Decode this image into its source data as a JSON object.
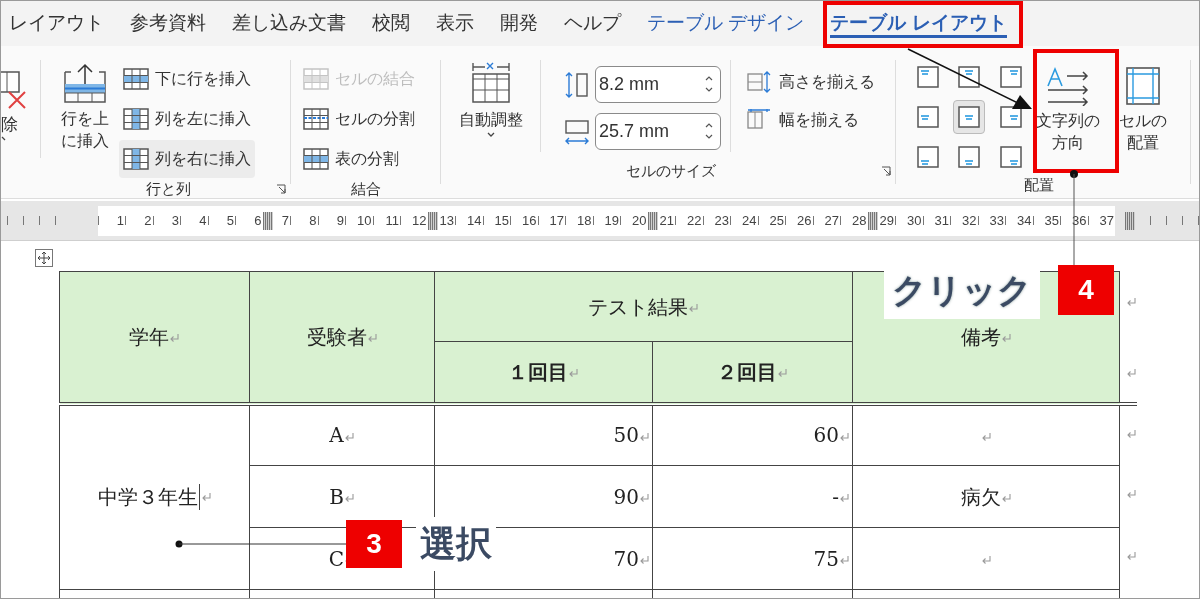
{
  "tabs": [
    {
      "label": "レイアウト",
      "selected": false,
      "kind": "normal"
    },
    {
      "label": "参考資料",
      "selected": false,
      "kind": "normal"
    },
    {
      "label": "差し込み文書",
      "selected": false,
      "kind": "normal"
    },
    {
      "label": "校閲",
      "selected": false,
      "kind": "normal"
    },
    {
      "label": "表示",
      "selected": false,
      "kind": "normal"
    },
    {
      "label": "開発",
      "selected": false,
      "kind": "normal"
    },
    {
      "label": "ヘルプ",
      "selected": false,
      "kind": "normal"
    },
    {
      "label": "テーブル デザイン",
      "selected": false,
      "kind": "context"
    },
    {
      "label": "テーブル レイアウト",
      "selected": true,
      "kind": "context"
    }
  ],
  "ribbon": {
    "delete_group": {
      "label": "除"
    },
    "rows_columns": {
      "title": "行と列",
      "insert_above": [
        "行を上",
        "に挿入"
      ],
      "items": [
        {
          "label": "下に行を挿入",
          "selected": false
        },
        {
          "label": "列を左に挿入",
          "selected": false
        },
        {
          "label": "列を右に挿入",
          "selected": true
        }
      ]
    },
    "merge": {
      "title": "結合",
      "items": [
        {
          "label": "セルの結合",
          "disabled": true
        },
        {
          "label": "セルの分割",
          "disabled": false
        },
        {
          "label": "表の分割",
          "disabled": false
        }
      ]
    },
    "cell_size": {
      "title": "セルのサイズ",
      "autofit": "自動調整",
      "height": "8.2 mm",
      "width": "25.7 mm",
      "distribute": [
        "高さを揃える",
        "幅を揃える"
      ]
    },
    "alignment": {
      "title": "配置",
      "grid": [
        {
          "selected": false
        },
        {
          "selected": false
        },
        {
          "selected": false
        },
        {
          "selected": false
        },
        {
          "selected": true
        },
        {
          "selected": false
        },
        {
          "selected": false
        },
        {
          "selected": false
        },
        {
          "selected": false
        }
      ],
      "text_direction": [
        "文字列の",
        "方向"
      ],
      "cell_margins": [
        "セルの",
        "配置"
      ]
    }
  },
  "ruler": {
    "numbers": [
      {
        "label": "1"
      },
      {
        "label": "2"
      },
      {
        "label": "3"
      },
      {
        "label": "4"
      },
      {
        "label": "5"
      },
      {
        "label": "6"
      },
      {
        "label": "7",
        "column_marker": true
      },
      {
        "label": "8"
      },
      {
        "label": "9"
      },
      {
        "label": "10"
      },
      {
        "label": "11"
      },
      {
        "label": "12"
      },
      {
        "label": "13",
        "column_marker": true
      },
      {
        "label": "14"
      },
      {
        "label": "15"
      },
      {
        "label": "16"
      },
      {
        "label": "17"
      },
      {
        "label": "18"
      },
      {
        "label": "19"
      },
      {
        "label": "20"
      },
      {
        "label": "21",
        "column_marker": true
      },
      {
        "label": "22"
      },
      {
        "label": "23"
      },
      {
        "label": "24"
      },
      {
        "label": "25"
      },
      {
        "label": "26"
      },
      {
        "label": "27"
      },
      {
        "label": "28"
      },
      {
        "label": "29",
        "column_marker": true
      },
      {
        "label": "30"
      },
      {
        "label": "31"
      },
      {
        "label": "32"
      },
      {
        "label": "33"
      },
      {
        "label": "34"
      },
      {
        "label": "35"
      },
      {
        "label": "36"
      },
      {
        "label": "37"
      }
    ]
  },
  "table": {
    "headers": {
      "grade": "学年",
      "examinee": "受験者",
      "results": "テスト結果",
      "first": "１回目",
      "second": "２回目",
      "note": "備考"
    },
    "grade": "中学３年生",
    "rows": [
      {
        "examinee": "A",
        "first": "50",
        "second": "60"
      },
      {
        "examinee": "B",
        "first": "90",
        "second": "-",
        "note": "病欠"
      },
      {
        "examinee": "C",
        "first": "70",
        "second": "75"
      }
    ]
  },
  "callouts": [
    {
      "number": "3",
      "text": "選択"
    },
    {
      "number": "4",
      "text": "クリック"
    }
  ]
}
